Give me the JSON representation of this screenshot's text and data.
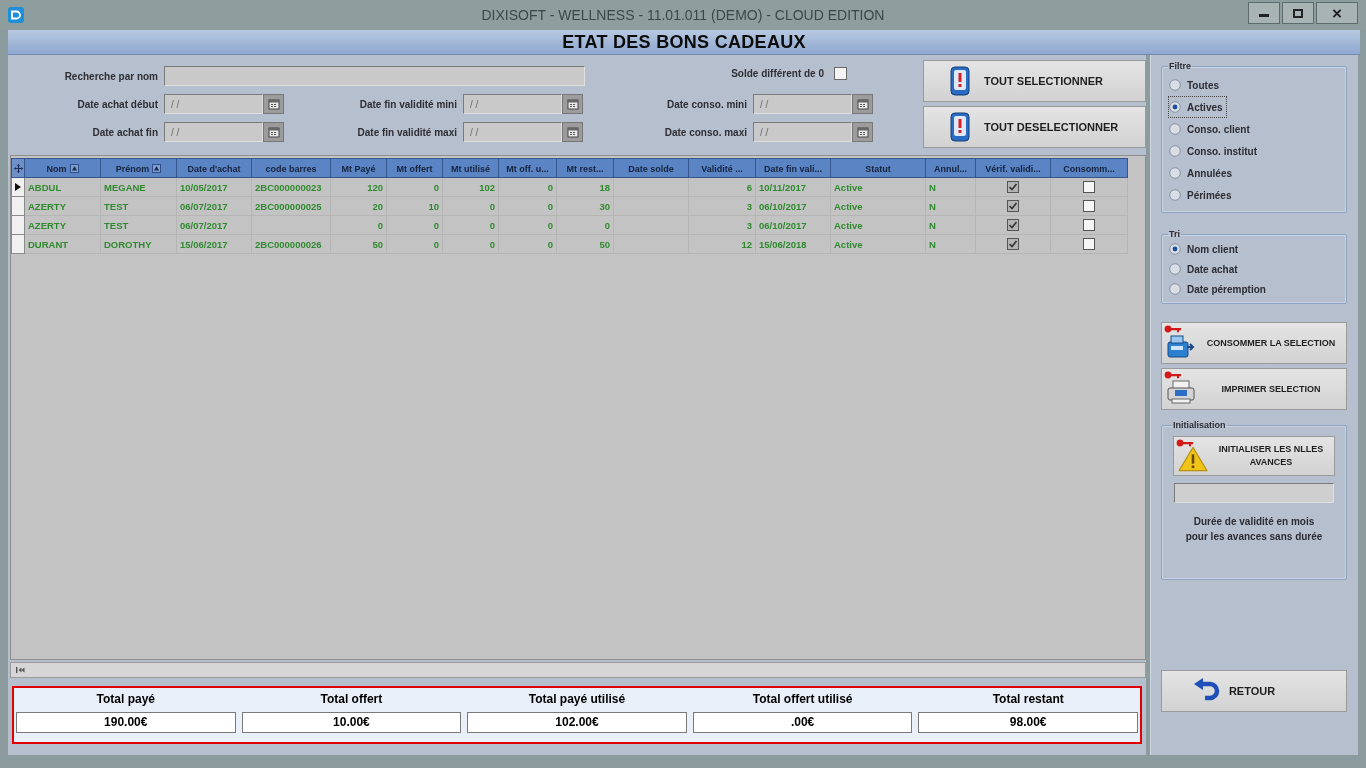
{
  "window": {
    "title": "DIXISOFT - WELLNESS - 11.01.011 (DEMO) - CLOUD EDITION"
  },
  "header": {
    "title": "ETAT DES BONS CADEAUX"
  },
  "filters": {
    "name_search": {
      "label": "Recherche par nom"
    },
    "balance_filter": {
      "label": "Solde différent de 0",
      "checked": false
    },
    "date_fields": [
      {
        "label": "Date achat début",
        "placeholder": "/ /"
      },
      {
        "label": "Date fin validité mini",
        "placeholder": "/ /"
      },
      {
        "label": "Date conso. mini",
        "placeholder": "/ /"
      },
      {
        "label": "Date achat fin",
        "placeholder": "/ /"
      },
      {
        "label": "Date fin validité maxi",
        "placeholder": "/ /"
      },
      {
        "label": "Date conso. maxi",
        "placeholder": "/ /"
      }
    ]
  },
  "actions": [
    {
      "label": "TOUT SELECTIONNER"
    },
    {
      "label": "TOUT DESELECTIONNER"
    }
  ],
  "table": {
    "columns": [
      {
        "label": "Nom",
        "kind": "text",
        "sort_icon": true
      },
      {
        "label": "Prénom",
        "kind": "text",
        "sort_icon": true
      },
      {
        "label": "Date d'achat",
        "kind": "text",
        "sort_icon": false
      },
      {
        "label": "code barres",
        "kind": "text",
        "sort_icon": false
      },
      {
        "label": "Mt Payé",
        "kind": "number",
        "sort_icon": false
      },
      {
        "label": "Mt offert",
        "kind": "number",
        "sort_icon": false
      },
      {
        "label": "Mt utilisé",
        "kind": "number",
        "sort_icon": false
      },
      {
        "label": "Mt off. u...",
        "kind": "number",
        "sort_icon": false
      },
      {
        "label": "Mt rest...",
        "kind": "number",
        "sort_icon": false
      },
      {
        "label": "Date solde",
        "kind": "text",
        "sort_icon": false
      },
      {
        "label": "Validité ...",
        "kind": "number",
        "sort_icon": false
      },
      {
        "label": "Date fin vali...",
        "kind": "text",
        "sort_icon": false
      },
      {
        "label": "Statut",
        "kind": "text",
        "sort_icon": false
      },
      {
        "label": "Annul...",
        "kind": "text",
        "sort_icon": false
      },
      {
        "label": "Vérif. validi...",
        "kind": "check",
        "sort_icon": false
      },
      {
        "label": "Consomm...",
        "kind": "check",
        "sort_icon": false
      }
    ],
    "rows": [
      {
        "selected": true,
        "cells": [
          "ABDUL",
          "MEGANE",
          "10/05/2017",
          "2BC000000023",
          "120",
          "0",
          "102",
          "0",
          "18",
          null,
          "6",
          "10/11/2017",
          "Active",
          "N",
          {
            "checked": true
          },
          {
            "checked": false
          }
        ]
      },
      {
        "selected": false,
        "cells": [
          "AZERTY",
          "TEST",
          "06/07/2017",
          "2BC000000025",
          "20",
          "10",
          "0",
          "0",
          "30",
          null,
          "3",
          "06/10/2017",
          "Active",
          "N",
          {
            "checked": true
          },
          {
            "checked": false
          }
        ]
      },
      {
        "selected": false,
        "cells": [
          "AZERTY",
          "TEST",
          "06/07/2017",
          null,
          "0",
          "0",
          "0",
          "0",
          "0",
          null,
          "3",
          "06/10/2017",
          "Active",
          "N",
          {
            "checked": true
          },
          {
            "checked": false
          }
        ]
      },
      {
        "selected": false,
        "cells": [
          "DURANT",
          "DOROTHY",
          "15/06/2017",
          "2BC000000026",
          "50",
          "0",
          "0",
          "0",
          "50",
          null,
          "12",
          "15/06/2018",
          "Active",
          "N",
          {
            "checked": true
          },
          {
            "checked": false
          }
        ]
      }
    ]
  },
  "totals": [
    {
      "label": "Total payé",
      "value": "190.00€"
    },
    {
      "label": "Total offert",
      "value": "10.00€"
    },
    {
      "label": "Total payé utilisé",
      "value": "102.00€"
    },
    {
      "label": "Total offert utilisé",
      "value": ".00€"
    },
    {
      "label": "Total restant",
      "value": "98.00€"
    }
  ],
  "side_panel": {
    "filter_group": {
      "title": "Filtre",
      "options": [
        {
          "label": "Toutes",
          "selected": false,
          "focused": false
        },
        {
          "label": "Actives",
          "selected": true,
          "focused": true
        },
        {
          "label": "Conso. client",
          "selected": false,
          "focused": false
        },
        {
          "label": "Conso. institut",
          "selected": false,
          "focused": false
        },
        {
          "label": "Annulées",
          "selected": false,
          "focused": false
        },
        {
          "label": "Périmées",
          "selected": false,
          "focused": false
        }
      ]
    },
    "sort_group": {
      "title": "Tri",
      "options": [
        {
          "label": "Nom client",
          "selected": true
        },
        {
          "label": "Date achat",
          "selected": false
        },
        {
          "label": "Date péremption",
          "selected": false
        }
      ]
    },
    "actions": [
      {
        "kind": "consume",
        "label": "CONSOMMER LA SELECTION"
      },
      {
        "kind": "print",
        "label": "IMPRIMER SELECTION"
      }
    ],
    "initialisation": {
      "title": "Initialisation",
      "button": "INITIALISER LES NLLES AVANCES",
      "note": "Durée de validité en mois pour les avances sans durée"
    },
    "return_button": {
      "label": "RETOUR"
    }
  }
}
